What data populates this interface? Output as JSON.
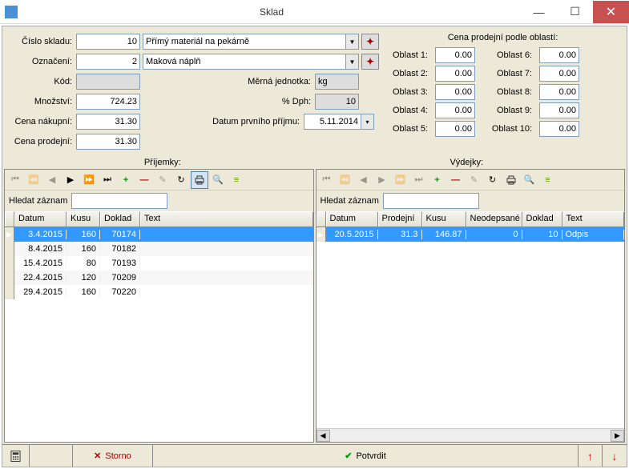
{
  "window": {
    "title": "Sklad"
  },
  "form": {
    "cislo_skladu_lbl": "Číslo skladu:",
    "cislo_skladu": "10",
    "sklad_popis": "Přímý materiál na pekárně",
    "oznaceni_lbl": "Označení:",
    "oznaceni": "2",
    "oznaceni_popis": "Maková náplň",
    "kod_lbl": "Kód:",
    "kod": "",
    "merna_lbl": "Měrná jednotka:",
    "merna": "kg",
    "mnozstvi_lbl": "Množství:",
    "mnozstvi": "724.23",
    "dph_lbl": "% Dph:",
    "dph": "10",
    "nakupni_lbl": "Cena nákupní:",
    "nakupni": "31.30",
    "datum_lbl": "Datum prvního příjmu:",
    "datum": "5.11.2014",
    "prodejni_lbl": "Cena prodejní:",
    "prodejni": "31.30"
  },
  "oblasti": {
    "title": "Cena prodejní podle oblastí:",
    "left": [
      {
        "lbl": "Oblast 1:",
        "v": "0.00"
      },
      {
        "lbl": "Oblast 2:",
        "v": "0.00"
      },
      {
        "lbl": "Oblast 3:",
        "v": "0.00"
      },
      {
        "lbl": "Oblast 4:",
        "v": "0.00"
      },
      {
        "lbl": "Oblast 5:",
        "v": "0.00"
      }
    ],
    "right": [
      {
        "lbl": "Oblast 6:",
        "v": "0.00"
      },
      {
        "lbl": "Oblast 7:",
        "v": "0.00"
      },
      {
        "lbl": "Oblast 8:",
        "v": "0.00"
      },
      {
        "lbl": "Oblast 9:",
        "v": "0.00"
      },
      {
        "lbl": "Oblast 10:",
        "v": "0.00"
      }
    ]
  },
  "sections": {
    "prijemky": "Příjemky:",
    "vydejky": "Výdejky:"
  },
  "search_lbl": "Hledat záznam",
  "prijemky": {
    "cols": [
      "Datum",
      "Kusu",
      "Doklad",
      "Text"
    ],
    "rows": [
      {
        "datum": "3.4.2015",
        "kusu": "160",
        "doklad": "70174",
        "text": ""
      },
      {
        "datum": "8.4.2015",
        "kusu": "160",
        "doklad": "70182",
        "text": ""
      },
      {
        "datum": "15.4.2015",
        "kusu": "80",
        "doklad": "70193",
        "text": ""
      },
      {
        "datum": "22.4.2015",
        "kusu": "120",
        "doklad": "70209",
        "text": ""
      },
      {
        "datum": "29.4.2015",
        "kusu": "160",
        "doklad": "70220",
        "text": ""
      }
    ]
  },
  "vydejky": {
    "cols": [
      "Datum",
      "Prodejní",
      "Kusu",
      "Neodepsané",
      "Doklad",
      "Text"
    ],
    "rows": [
      {
        "datum": "20.5.2015",
        "prodejni": "31.3",
        "kusu": "146.87",
        "neod": "0",
        "doklad": "10",
        "text": "Odpis"
      }
    ]
  },
  "footer": {
    "storno": "Storno",
    "potvrdit": "Potvrdit"
  }
}
